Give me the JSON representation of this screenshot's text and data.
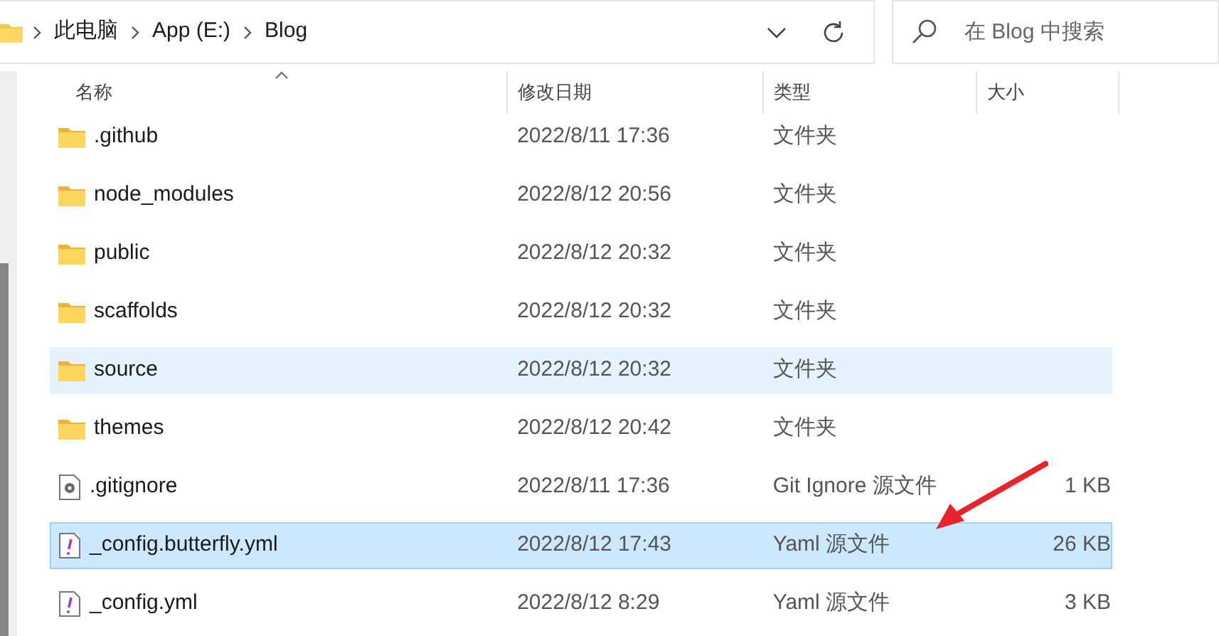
{
  "address_bar": {
    "breadcrumbs": [
      {
        "label": "此电脑"
      },
      {
        "label": "App (E:)"
      },
      {
        "label": "Blog"
      }
    ]
  },
  "search": {
    "placeholder": "在 Blog 中搜索"
  },
  "table": {
    "columns": [
      "名称",
      "修改日期",
      "类型",
      "大小"
    ],
    "rows": [
      {
        "kind": "folder",
        "name": ".github",
        "date": "2022/8/11 17:36",
        "type": "文件夹",
        "selected": false,
        "hovered": false
      },
      {
        "kind": "folder",
        "name": "node_modules",
        "date": "2022/8/12 20:56",
        "type": "文件夹",
        "selected": false,
        "hovered": false
      },
      {
        "kind": "folder",
        "name": "public",
        "date": "2022/8/12 20:32",
        "type": "文件夹",
        "selected": false,
        "hovered": false
      },
      {
        "kind": "folder",
        "name": "scaffolds",
        "date": "2022/8/12 20:32",
        "type": "文件夹",
        "selected": false,
        "hovered": false
      },
      {
        "kind": "folder",
        "name": "source",
        "date": "2022/8/12 20:32",
        "type": "文件夹",
        "selected": false,
        "hovered": true
      },
      {
        "kind": "folder",
        "name": "themes",
        "date": "2022/8/12 20:42",
        "type": "文件夹",
        "selected": false,
        "hovered": false
      },
      {
        "kind": "settings-file",
        "name": ".gitignore",
        "date": "2022/8/11 17:36",
        "type": "Git Ignore 源文件",
        "size": "1 KB",
        "selected": false,
        "hovered": false
      },
      {
        "kind": "yaml-file",
        "name": "_config.butterfly.yml",
        "date": "2022/8/12 17:43",
        "type": "Yaml 源文件",
        "size": "26 KB",
        "selected": true,
        "hovered": false
      },
      {
        "kind": "yaml-file",
        "name": "_config.yml",
        "date": "2022/8/12 8:29",
        "type": "Yaml 源文件",
        "size": "3 KB",
        "selected": false,
        "hovered": false
      }
    ]
  }
}
